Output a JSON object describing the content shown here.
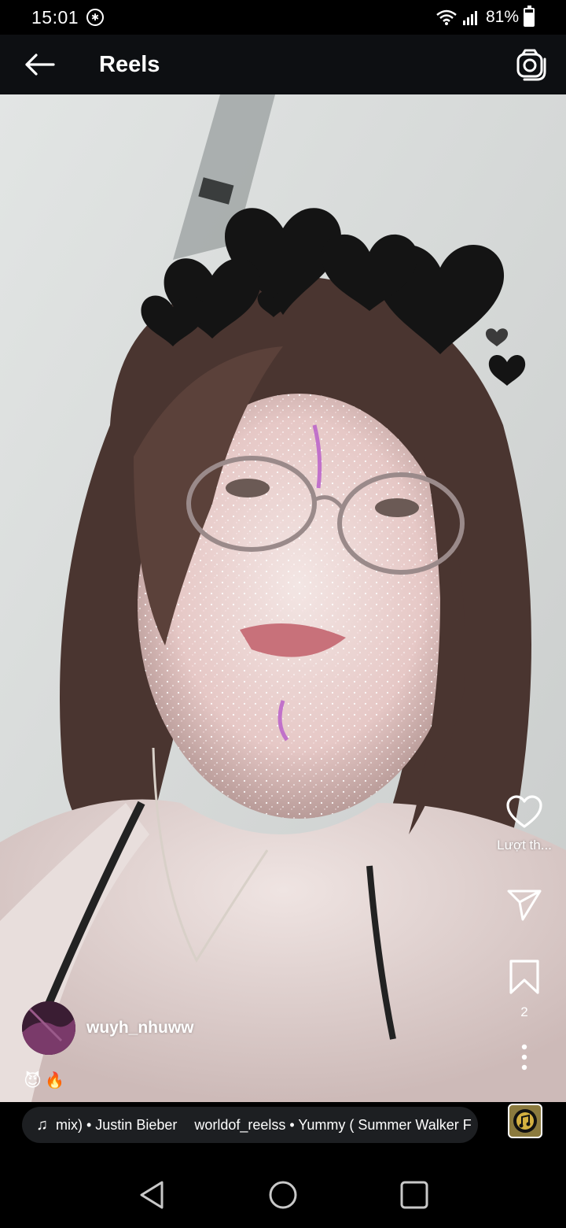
{
  "status_bar": {
    "time": "15:01",
    "battery": "81%",
    "battery_level": 0.81
  },
  "header": {
    "title": "Reels"
  },
  "actions": {
    "like_label": "Lượt th...",
    "save_count": "2"
  },
  "author": {
    "username": "wuyh_nhuww",
    "caption_emojis": [
      "😈",
      "🔥"
    ]
  },
  "music": {
    "part1": "mix) • Justin Bieber",
    "part2": "worldof_reelss • Yummy ( Summer Walker F"
  },
  "colors": {
    "header_bg": "#0d0f12",
    "music_pill_bg": "#1d1f22"
  },
  "icons": [
    "back-arrow-icon",
    "camera-icon",
    "heart-icon",
    "send-icon",
    "bookmark-icon",
    "more-vertical-icon",
    "music-note-icon",
    "nav-back-icon",
    "nav-home-icon",
    "nav-recents-icon"
  ]
}
